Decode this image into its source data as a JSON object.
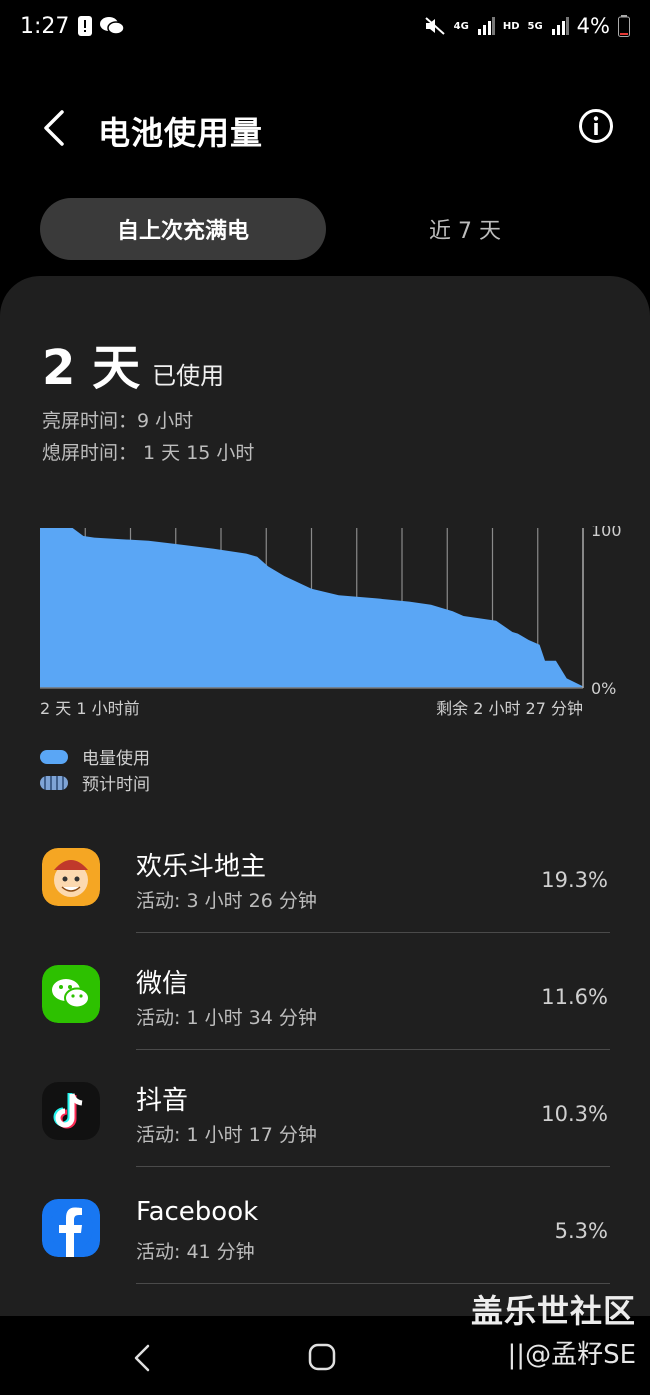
{
  "status_bar": {
    "time": "1:27",
    "net_4g": "4G",
    "hd": "HD",
    "net_5g": "5G",
    "battery_pct": "4%"
  },
  "header": {
    "title": "电池使用量"
  },
  "tabs": [
    {
      "label": "自上次充满电",
      "active": true
    },
    {
      "label": "近 7 天",
      "active": false
    }
  ],
  "summary": {
    "used_num": "2 天",
    "used_suffix": "已使用",
    "screen_on": "亮屏时间：9 小时",
    "screen_off": "熄屏时间： 1 天 15 小时"
  },
  "chart_data": {
    "type": "area",
    "y_tick_max": "100",
    "y_tick_min": "0%",
    "x_start_label": "2 天 1 小时前",
    "x_end_label": "剩余 2 小时 27 分钟",
    "ylim": [
      0,
      100
    ],
    "x": [
      0,
      6,
      8,
      10,
      15,
      20,
      25,
      32,
      38,
      40,
      42,
      45,
      50,
      55,
      62,
      68,
      72,
      74,
      76,
      78,
      84,
      87,
      88,
      90,
      92,
      93,
      95,
      97,
      100
    ],
    "values": [
      100,
      100,
      95,
      94,
      93,
      92,
      90,
      87,
      84,
      82,
      76,
      70,
      62,
      58,
      56,
      54,
      52,
      50,
      48,
      45,
      42,
      35,
      34,
      30,
      27,
      17,
      17,
      6,
      1
    ],
    "grid": true,
    "color": "#5aa6f5"
  },
  "legend": {
    "used": "电量使用",
    "estimated": "预计时间"
  },
  "apps": [
    {
      "name": "欢乐斗地主",
      "usage": "活动: 3 小时 26 分钟",
      "percent": "19.3%",
      "icon": "doudizhu-icon"
    },
    {
      "name": "微信",
      "usage": "活动: 1 小时 34 分钟",
      "percent": "11.6%",
      "icon": "wechat-icon"
    },
    {
      "name": "抖音",
      "usage": "活动: 1 小时 17 分钟",
      "percent": "10.3%",
      "icon": "douyin-icon"
    },
    {
      "name": "Facebook",
      "usage": "活动: 41 分钟",
      "percent": "5.3%",
      "icon": "facebook-icon"
    }
  ],
  "watermark": {
    "line1": "盖乐世社区",
    "line2": "||@孟籽SE"
  }
}
